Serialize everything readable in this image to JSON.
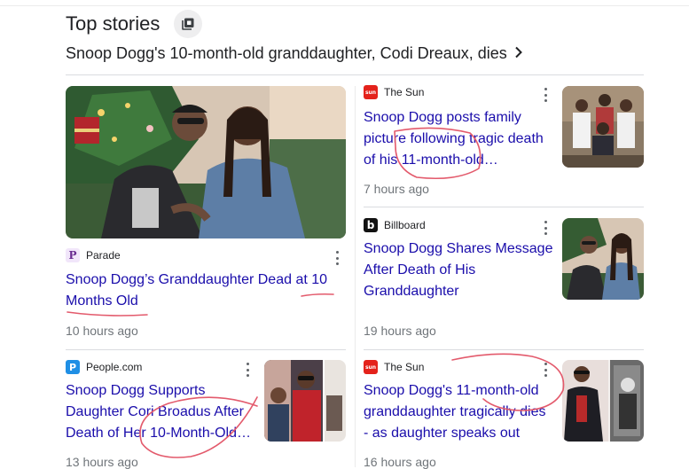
{
  "header": {
    "title": "Top stories"
  },
  "subhead": {
    "text": "Snoop Dogg's 10-month-old granddaughter, Codi Dreaux, dies"
  },
  "cards": [
    {
      "source": "Parade",
      "logo_letter": "P",
      "logo_bg": "#f1e6fa",
      "logo_color": "#6a2c91",
      "title_lines": [
        "Snoop Dogg’s Granddaughter Dead at 10",
        "Months Old"
      ],
      "time": "10 hours ago"
    },
    {
      "source": "The Sun",
      "logo_letter": "sun",
      "logo_bg": "#e4221b",
      "logo_color": "#ffffff",
      "title_lines": [
        "Snoop Dogg posts family",
        "picture following tragic death",
        "of his 11-month-old…"
      ],
      "time": "7 hours ago"
    },
    {
      "source": "Billboard",
      "logo_letter": "b",
      "logo_bg": "#111111",
      "logo_color": "#ffffff",
      "title_lines": [
        "Snoop Dogg Shares Message",
        "After Death of His",
        "Granddaughter"
      ],
      "time": "19 hours ago"
    },
    {
      "source": "People.com",
      "logo_letter": "P",
      "logo_bg": "#1f8fe5",
      "logo_color": "#ffffff",
      "title_lines": [
        "Snoop Dogg Supports",
        "Daughter Cori Broadus After",
        "Death of Her 10-Month-Old…"
      ],
      "time": "13 hours ago"
    },
    {
      "source": "The Sun",
      "logo_letter": "sun",
      "logo_bg": "#e4221b",
      "logo_color": "#ffffff",
      "title_lines": [
        "Snoop Dogg's 11-month-old",
        "granddaughter tragically dies",
        "- as daughter speaks out"
      ],
      "time": "16 hours ago"
    }
  ],
  "colors": {
    "link": "#1a0dab",
    "muted": "#70757a",
    "annotation": "#e35a6c"
  }
}
